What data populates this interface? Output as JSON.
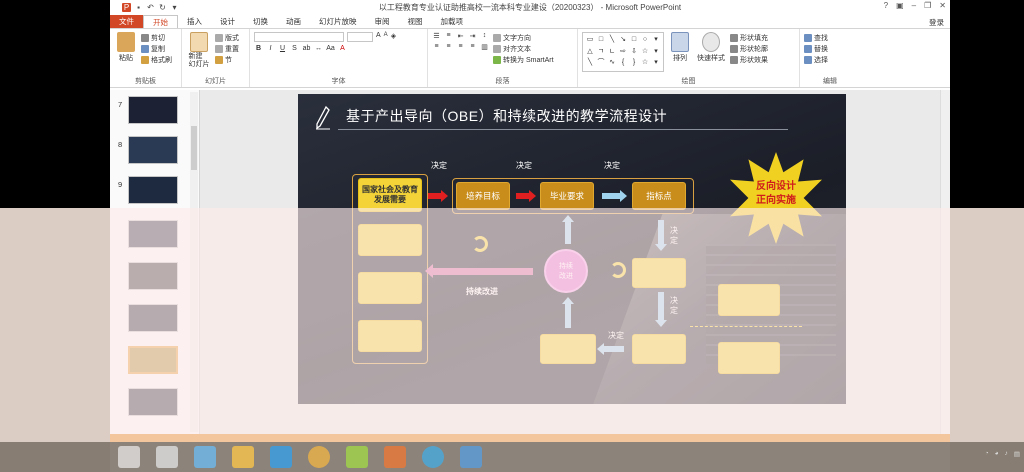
{
  "app": {
    "title": "以工程教育专业认证助推高校一流本科专业建设（20200323） - Microsoft PowerPoint",
    "login": "登录"
  },
  "tabs": [
    "文件",
    "开始",
    "插入",
    "设计",
    "切换",
    "动画",
    "幻灯片放映",
    "审阅",
    "视图",
    "加载项"
  ],
  "ribbon": {
    "clipboard": {
      "paste": "粘贴",
      "cut": "剪切",
      "copy": "复制",
      "format_painter": "格式刷",
      "label": "剪贴板"
    },
    "slides": {
      "new_slide": "新建\n幻灯片",
      "layout": "版式",
      "reset": "重置",
      "section": "节",
      "label": "幻灯片"
    },
    "font": {
      "label": "字体"
    },
    "paragraph": {
      "text_direction": "文字方向",
      "align_text": "对齐文本",
      "smartart": "转换为 SmartArt",
      "label": "段落"
    },
    "drawing": {
      "arrange": "排列",
      "quick_styles": "快速样式",
      "shape_fill": "形状填充",
      "shape_outline": "形状轮廓",
      "shape_effects": "形状效果",
      "label": "绘图"
    },
    "editing": {
      "find": "查找",
      "replace": "替换",
      "select": "选择",
      "label": "编辑"
    }
  },
  "slide_pane": {
    "numbers": [
      "7",
      "8",
      "9"
    ]
  },
  "slide": {
    "title": "基于产出导向（OBE）和持续改进的教学流程设计",
    "decide": "决定",
    "left_box_top": "国家社会及教育发展需要",
    "top_boxes": [
      "培养目标",
      "毕业要求",
      "指标点"
    ],
    "star_text": "反向设计\n正向实施",
    "continuous_improve": "持续改进",
    "circle_text": "持续\n改进",
    "colors": {
      "slide_bg": "#1e222c",
      "yellow_box": "#f3d337",
      "orange_box": "#c98d1b",
      "red_arrow": "#e02020",
      "blue_arrow": "#9fd3ee",
      "star": "#f0d020",
      "star_text": "#d01c1c",
      "circle": "#e46fd4"
    }
  }
}
